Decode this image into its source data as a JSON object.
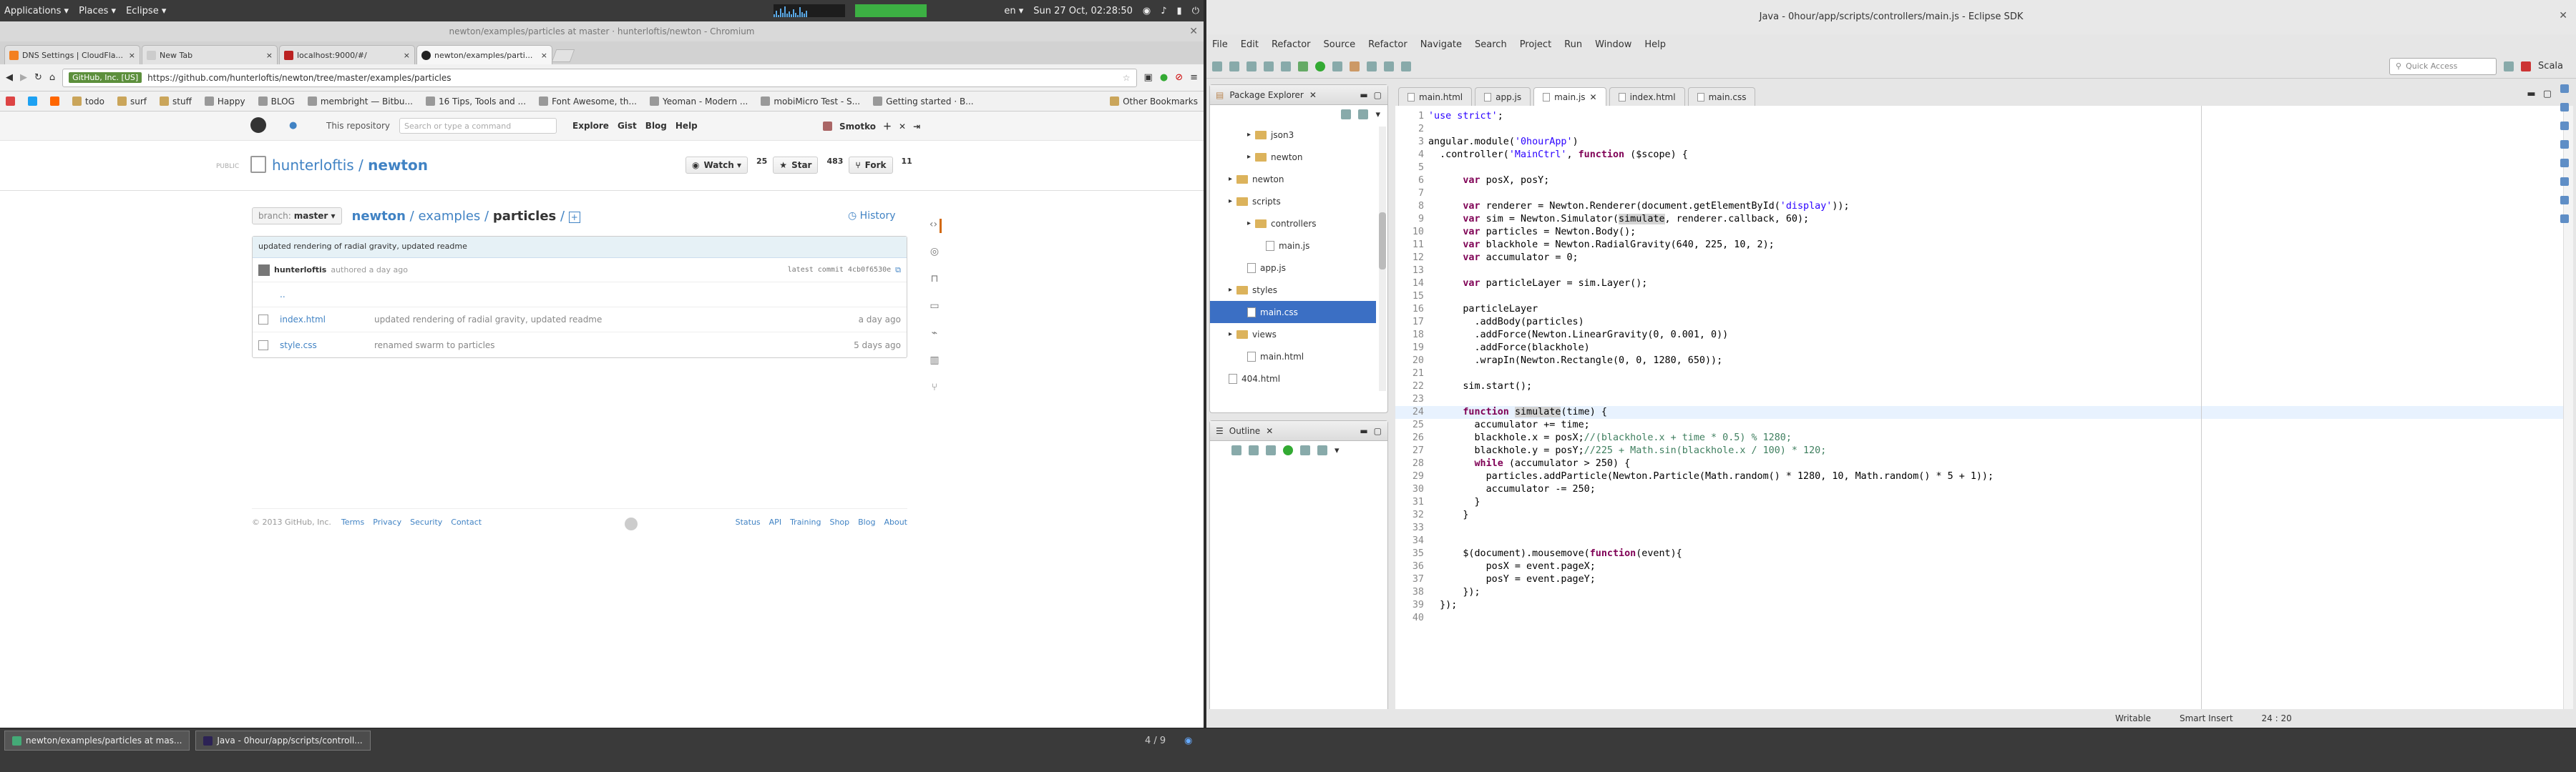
{
  "system_panel": {
    "applications": "Applications ▾",
    "places": "Places ▾",
    "eclipse": "Eclipse ▾",
    "lang": "en ▾",
    "clock": "Sun 27 Oct, 02:28:50"
  },
  "chromium": {
    "title": "newton/examples/particles at master · hunterloftis/newton - Chromium",
    "tabs": [
      {
        "label": "DNS Settings | CloudFla...",
        "color": "#f38020"
      },
      {
        "label": "New Tab",
        "color": "#cccccc"
      },
      {
        "label": "localhost:9000/#/",
        "color": "#b22"
      },
      {
        "label": "newton/examples/parti...",
        "color": "#222"
      }
    ],
    "url_ev": "GitHub, Inc. [US]",
    "url": "https://github.com/hunterloftis/newton/tree/master/examples/particles",
    "bookmarks": [
      "todo",
      "surf",
      "stuff",
      "Happy",
      "BLOG",
      "membright — Bitbu...",
      "16 Tips, Tools and ...",
      "Font Awesome, th...",
      "Yeoman - Modern ...",
      "mobiMicro Test - S...",
      "Getting started · B..."
    ],
    "other_bookmarks": "Other Bookmarks"
  },
  "github": {
    "repo_context": "This repository",
    "search_placeholder": "Search or type a command",
    "nav": [
      "Explore",
      "Gist",
      "Blog",
      "Help"
    ],
    "username": "Smotko",
    "public": "PUBLIC",
    "owner": "hunterloftis",
    "slash": " / ",
    "repo": "newton",
    "watch": "Watch ▾",
    "watch_count": "25",
    "star": "Star",
    "star_count": "483",
    "fork": "Fork",
    "fork_count": "11",
    "branch_label": "branch:",
    "branch": "master ▾",
    "crumb_repo": "newton",
    "crumb_mid": " / examples / ",
    "crumb_current": "particles",
    "crumb_end": " / ",
    "history": "History",
    "commit_message": "updated rendering of radial gravity, updated readme",
    "commit_author": "hunterloftis",
    "commit_when": "authored a day ago",
    "latest_commit": "latest commit 4cb0f6530e",
    "parent_dir": "..",
    "files": [
      {
        "name": "index.html",
        "message": "updated rendering of radial gravity, updated readme",
        "age": "a day ago"
      },
      {
        "name": "style.css",
        "message": "renamed swarm to particles",
        "age": "5 days ago"
      }
    ],
    "footer_copyright": "© 2013 GitHub, Inc.",
    "footer_left": [
      "Terms",
      "Privacy",
      "Security",
      "Contact"
    ],
    "footer_right": [
      "Status",
      "API",
      "Training",
      "Shop",
      "Blog",
      "About"
    ]
  },
  "taskbar": {
    "items": [
      "newton/examples/particles at mas...",
      "Java - 0hour/app/scripts/controll..."
    ],
    "pager": "4 / 9"
  },
  "eclipse": {
    "title": "Java - 0hour/app/scripts/controllers/main.js - Eclipse SDK",
    "menu": [
      "File",
      "Edit",
      "Refactor",
      "Source",
      "Refactor",
      "Navigate",
      "Search",
      "Project",
      "Run",
      "Window",
      "Help"
    ],
    "quick_access": "Quick Access",
    "perspective": "Scala",
    "package_explorer": "Package Explorer",
    "outline": "Outline",
    "tree": [
      {
        "label": "json3",
        "kind": "folder",
        "indent": 2,
        "selected": false
      },
      {
        "label": "newton",
        "kind": "folder",
        "indent": 2,
        "selected": false
      },
      {
        "label": "newton",
        "kind": "folder",
        "indent": 1,
        "selected": false
      },
      {
        "label": "scripts",
        "kind": "folder",
        "indent": 1,
        "selected": false
      },
      {
        "label": "controllers",
        "kind": "folder",
        "indent": 2,
        "selected": false
      },
      {
        "label": "main.js",
        "kind": "file",
        "indent": 3,
        "selected": false
      },
      {
        "label": "app.js",
        "kind": "file",
        "indent": 2,
        "selected": false
      },
      {
        "label": "styles",
        "kind": "folder",
        "indent": 1,
        "selected": false
      },
      {
        "label": "main.css",
        "kind": "file",
        "indent": 2,
        "selected": true
      },
      {
        "label": "views",
        "kind": "folder",
        "indent": 1,
        "selected": false
      },
      {
        "label": "main.html",
        "kind": "file",
        "indent": 2,
        "selected": false
      },
      {
        "label": "404.html",
        "kind": "file",
        "indent": 1,
        "selected": false
      }
    ],
    "editor_tabs": [
      {
        "label": "main.html",
        "active": false
      },
      {
        "label": "app.js",
        "active": false
      },
      {
        "label": "main.js",
        "active": true
      },
      {
        "label": "index.html",
        "active": false
      },
      {
        "label": "main.css",
        "active": false
      }
    ],
    "current_line": 24,
    "code": [
      "'use strict';",
      "",
      "angular.module('0hourApp')",
      "  .controller('MainCtrl', function ($scope) {",
      "",
      "      var posX, posY;",
      "",
      "      var renderer = Newton.Renderer(document.getElementById('display'));",
      "      var sim = Newton.Simulator(simulate, renderer.callback, 60);",
      "      var particles = Newton.Body();",
      "      var blackhole = Newton.RadialGravity(640, 225, 10, 2);",
      "      var accumulator = 0;",
      "",
      "      var particleLayer = sim.Layer();",
      "",
      "      particleLayer",
      "        .addBody(particles)",
      "        .addForce(Newton.LinearGravity(0, 0.001, 0))",
      "        .addForce(blackhole)",
      "        .wrapIn(Newton.Rectangle(0, 0, 1280, 650));",
      "",
      "      sim.start();",
      "",
      "      function simulate(time) {",
      "        accumulator += time;",
      "        blackhole.x = posX;//(blackhole.x + time * 0.5) % 1280;",
      "        blackhole.y = posY;//225 + Math.sin(blackhole.x / 100) * 120;",
      "        while (accumulator > 250) {",
      "          particles.addParticle(Newton.Particle(Math.random() * 1280, 10, Math.random() * 5 + 1));",
      "          accumulator -= 250;",
      "        }",
      "      }",
      "",
      "",
      "      $(document).mousemove(function(event){",
      "          posX = event.pageX;",
      "          posY = event.pageY;",
      "      });",
      "  });",
      ""
    ],
    "status": {
      "writable": "Writable",
      "insert": "Smart Insert",
      "position": "24 : 20"
    }
  },
  "colors": {
    "github_link": "#4183c4",
    "selection": "#3b6fc4",
    "keyword": "#7f0055",
    "string": "#2a00ff",
    "comment": "#3f7f5f"
  }
}
